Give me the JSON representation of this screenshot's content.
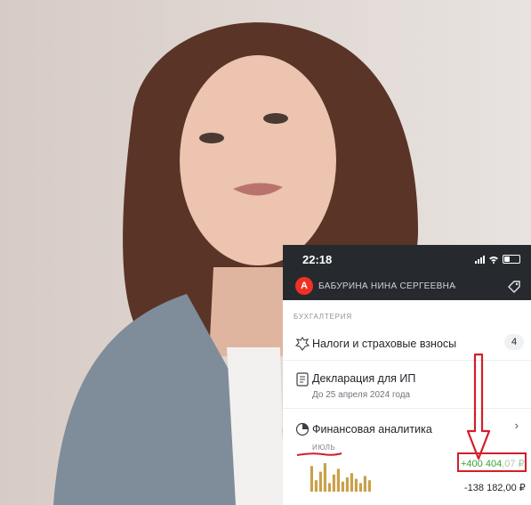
{
  "phone": {
    "status_time": "22:18",
    "account": {
      "logo_letter": "А",
      "name": "БАБУРИНА НИНА СЕРГЕЕВНА"
    },
    "section_label": "БУХГАЛТЕРИЯ",
    "taxes": {
      "title": "Налоги и страховые взносы",
      "count": "4"
    },
    "declaration": {
      "title": "Декларация для ИП",
      "subtitle": "До 25 апреля 2024 года"
    },
    "analytics": {
      "title": "Финансовая аналитика",
      "month": "ИЮЛЬ",
      "income": "+400 404",
      "income_cents": ",07 ₽",
      "expense": "-138 182,00 ₽",
      "bar_levels": [
        0.9,
        0.4,
        0.7,
        1.0,
        0.3,
        0.6,
        0.8,
        0.35,
        0.5,
        0.65,
        0.45,
        0.3,
        0.55,
        0.4
      ]
    }
  },
  "colors": {
    "header_bg": "#262a2e",
    "brand_red": "#ef3124",
    "annotation_red": "#d21f2b",
    "income_green": "#3aa13a",
    "bar_color": "#c9a14a"
  },
  "icons": {
    "signal": "signal-icon",
    "wifi": "wifi-icon",
    "battery": "battery-icon",
    "tag": "tag-icon",
    "emblem": "emblem-icon",
    "document": "document-icon",
    "analytics": "pie-chart-icon"
  }
}
